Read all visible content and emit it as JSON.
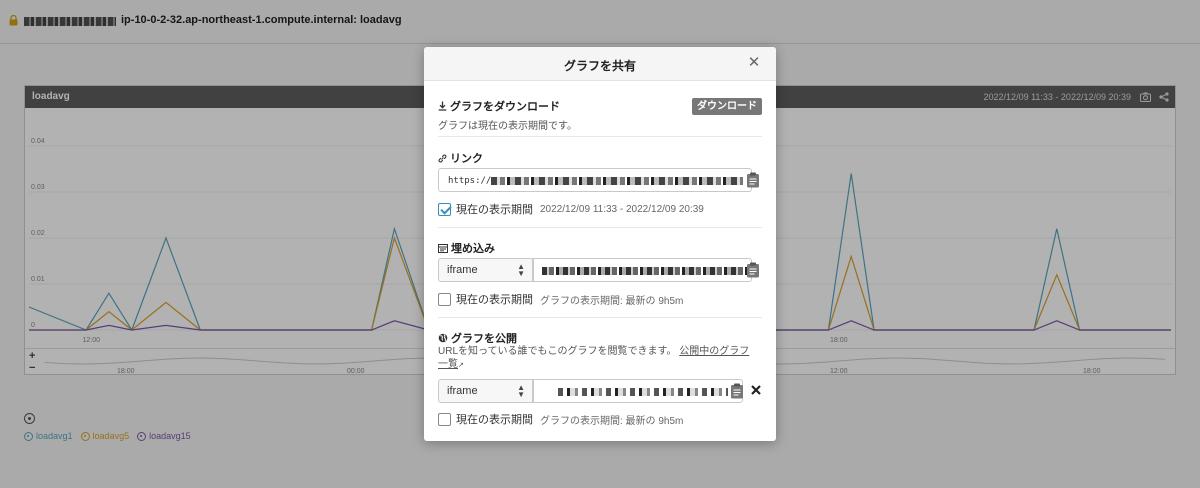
{
  "header": {
    "host_name": "ip-10-0-2-32.ap-northeast-1.compute.internal: loadavg",
    "lock_icon": "lock-icon"
  },
  "graph": {
    "name": "loadavg",
    "range": "2022/12/09 11:33 - 2022/12/09 20:39",
    "y_ticks": [
      "0.04",
      "0.03",
      "0.02",
      "0.01",
      "0"
    ],
    "x_ticks": [
      "12:00",
      "18:00"
    ],
    "nav_ticks": [
      "18:00",
      "00:00",
      "12:00",
      "18:00"
    ],
    "zoom_in": "+",
    "zoom_out": "−"
  },
  "legend": {
    "items": [
      {
        "label": "loadavg1",
        "color": "#5aa5bd"
      },
      {
        "label": "loadavg5",
        "color": "#d8a12d"
      },
      {
        "label": "loadavg15",
        "color": "#7b5aa6"
      }
    ]
  },
  "chart_data": {
    "type": "line",
    "ylim": [
      0,
      0.045
    ],
    "x": [
      0,
      5,
      7,
      9,
      12,
      15,
      17,
      20,
      30,
      32,
      35,
      42,
      44,
      46,
      50,
      60,
      70,
      72,
      74,
      80,
      88,
      90,
      92,
      100
    ],
    "series": [
      {
        "name": "loadavg1",
        "values": [
          0.005,
          0,
          0.008,
          0,
          0.02,
          0,
          0,
          0,
          0,
          0.022,
          0,
          0,
          0.008,
          0,
          0,
          0,
          0,
          0.034,
          0,
          0,
          0,
          0.022,
          0,
          0
        ]
      },
      {
        "name": "loadavg5",
        "values": [
          0,
          0,
          0.004,
          0,
          0.006,
          0,
          0,
          0,
          0,
          0.02,
          0,
          0,
          0.004,
          0,
          0,
          0,
          0,
          0.016,
          0,
          0,
          0,
          0.012,
          0,
          0
        ]
      },
      {
        "name": "loadavg15",
        "values": [
          0,
          0,
          0.001,
          0,
          0.001,
          0,
          0,
          0,
          0,
          0.002,
          0,
          0,
          0.001,
          0,
          0,
          0,
          0,
          0.002,
          0,
          0,
          0,
          0.002,
          0,
          0
        ]
      }
    ]
  },
  "modal": {
    "title": "グラフを共有",
    "download": {
      "title": "グラフをダウンロード",
      "desc": "グラフは現在の表示期間です。",
      "button": "ダウンロード"
    },
    "link": {
      "title": "リンク",
      "url_prefix": "https://",
      "current_period_label": "現在の表示期間",
      "current_period_value": "2022/12/09 11:33 - 2022/12/09 20:39",
      "checked": true
    },
    "embed": {
      "title": "埋め込み",
      "select_value": "iframe",
      "current_period_label": "現在の表示期間",
      "note": "グラフの表示期間: 最新の 9h5m",
      "checked": false
    },
    "publish": {
      "title": "グラフを公開",
      "desc": "URLを知っている誰でもこのグラフを閲覧できます。",
      "link_text": "公開中のグラフ一覧",
      "select_value": "iframe",
      "current_period_label": "現在の表示期間",
      "note": "グラフの表示期間: 最新の 9h5m",
      "checked": false
    }
  }
}
